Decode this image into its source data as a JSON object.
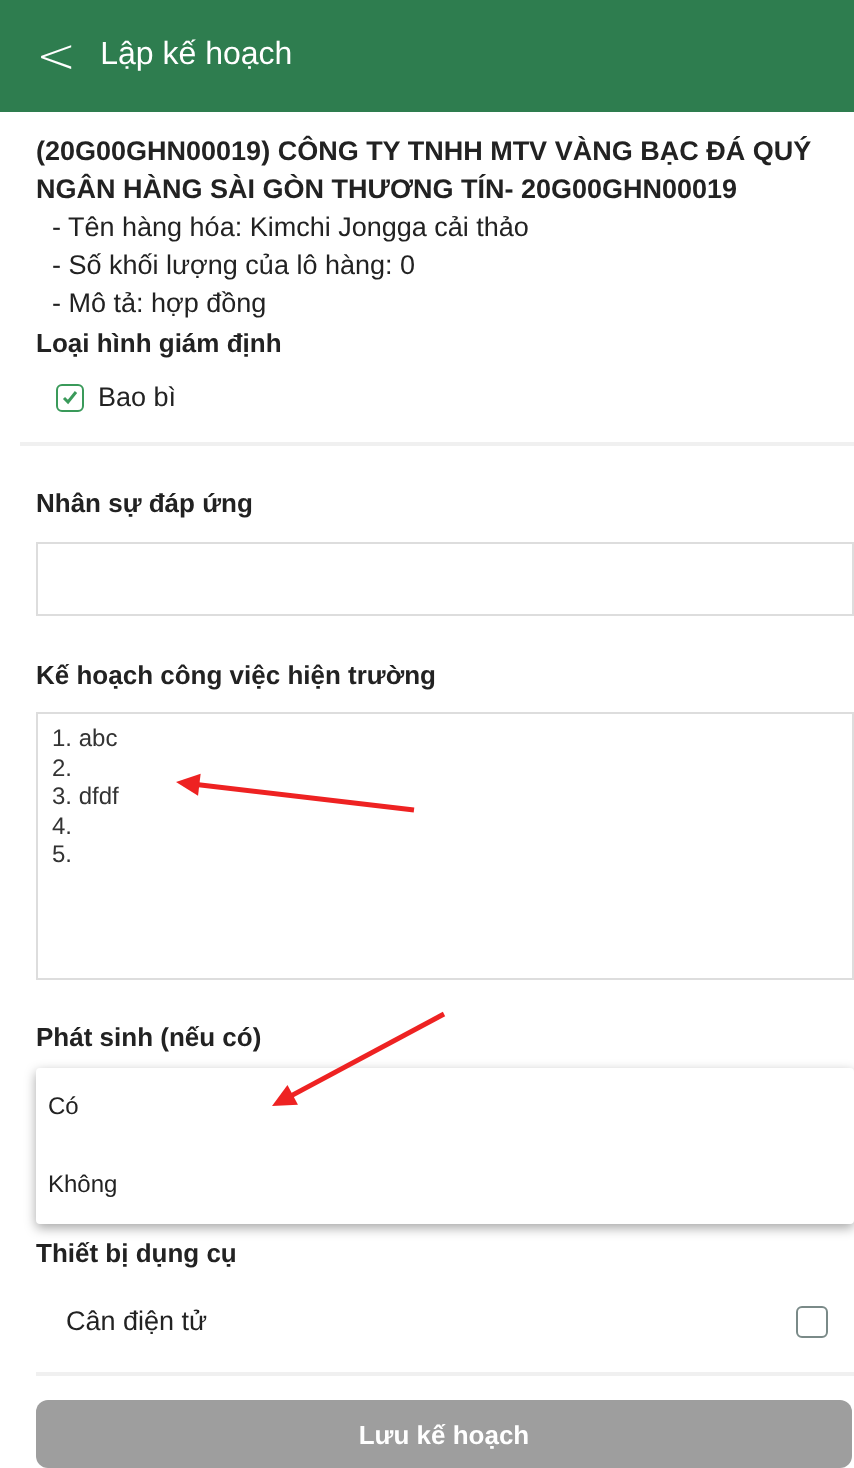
{
  "header": {
    "back": "<",
    "title": "Lập kế hoạch"
  },
  "order": {
    "title": "(20G00GHN00019) CÔNG TY TNHH MTV VÀNG BẠC ĐÁ QUÝ NGÂN HÀNG SÀI GÒN THƯƠNG TÍN- 20G00GHN00019",
    "details": [
      "- Tên hàng hóa: Kimchi Jongga cải thảo",
      "- Số khối lượng của lô hàng: 0",
      "- Mô tả: hợp đồng"
    ]
  },
  "inspection_type": {
    "label": "Loại hình giám định",
    "options": [
      {
        "label": "Bao bì",
        "checked": true
      }
    ]
  },
  "staff": {
    "label": "Nhân sự đáp ứng"
  },
  "field_plan": {
    "label": "Kế hoạch công việc hiện trường",
    "value": "1. abc\n2.\n3. dfdf\n4.\n5."
  },
  "incurred": {
    "label": "Phát sinh (nếu có)",
    "options": [
      {
        "label": "Có",
        "selected": false
      },
      {
        "label": "Không",
        "selected": false
      }
    ]
  },
  "equipment": {
    "label": "Thiết bị dụng cụ",
    "items": [
      {
        "label": "Cân điện tử",
        "checked": false
      }
    ]
  },
  "save_button": "Lưu kế hoạch"
}
